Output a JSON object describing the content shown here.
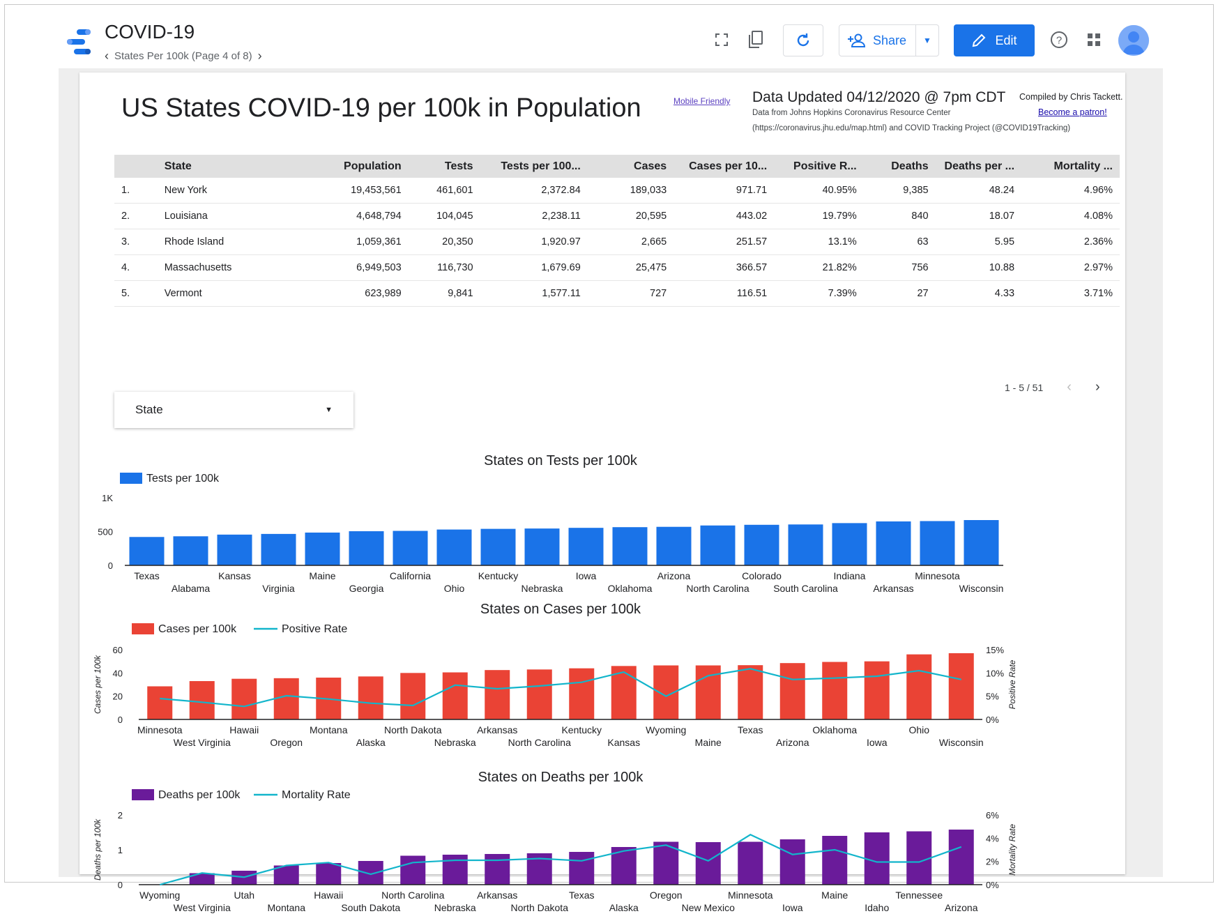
{
  "app": {
    "title": "COVID-19",
    "page_nav": "States Per 100k (Page 4 of 8)"
  },
  "toolbar": {
    "share_label": "Share",
    "edit_label": "Edit"
  },
  "report": {
    "title": "US States COVID-19 per 100k in Population",
    "mobile_link": "Mobile Friendly",
    "updated": "Data Updated 04/12/2020 @ 7pm CDT",
    "source_line1": "Data from Johns Hopkins Coronavirus Resource Center",
    "source_line2": "(https://coronavirus.jhu.edu/map.html) and COVID Tracking Project (@COVID19Tracking)",
    "compiled": "Compiled by Chris Tackett.",
    "patron_link": "Become a patron!"
  },
  "table": {
    "headers": [
      "State",
      "Population",
      "Tests",
      "Tests per 100...",
      "Cases",
      "Cases per 10...",
      "Positive R...",
      "Deaths",
      "Deaths per ...",
      "Mortality ..."
    ],
    "rows": [
      [
        "1.",
        "New York",
        "19,453,561",
        "461,601",
        "2,372.84",
        "189,033",
        "971.71",
        "40.95%",
        "9,385",
        "48.24",
        "4.96%"
      ],
      [
        "2.",
        "Louisiana",
        "4,648,794",
        "104,045",
        "2,238.11",
        "20,595",
        "443.02",
        "19.79%",
        "840",
        "18.07",
        "4.08%"
      ],
      [
        "3.",
        "Rhode Island",
        "1,059,361",
        "20,350",
        "1,920.97",
        "2,665",
        "251.57",
        "13.1%",
        "63",
        "5.95",
        "2.36%"
      ],
      [
        "4.",
        "Massachusetts",
        "6,949,503",
        "116,730",
        "1,679.69",
        "25,475",
        "366.57",
        "21.82%",
        "756",
        "10.88",
        "2.97%"
      ],
      [
        "5.",
        "Vermont",
        "623,989",
        "9,841",
        "1,577.11",
        "727",
        "116.51",
        "7.39%",
        "27",
        "4.33",
        "3.71%"
      ]
    ],
    "pager": "1 - 5 / 51"
  },
  "filter": {
    "label": "State"
  },
  "chart_data": [
    {
      "type": "bar",
      "title": "States on Tests per 100k",
      "categories": [
        "Texas",
        "Alabama",
        "Kansas",
        "Virginia",
        "Maine",
        "Georgia",
        "California",
        "Ohio",
        "Kentucky",
        "Nebraska",
        "Iowa",
        "Oklahoma",
        "Arizona",
        "North Carolina",
        "Colorado",
        "South Carolina",
        "Indiana",
        "Arkansas",
        "Minnesota",
        "Wisconsin"
      ],
      "series": [
        {
          "name": "Tests per 100k",
          "values": [
            420,
            430,
            455,
            465,
            485,
            505,
            510,
            530,
            540,
            545,
            555,
            565,
            570,
            590,
            600,
            605,
            625,
            650,
            655,
            670
          ]
        }
      ],
      "y_ticks": [
        "1K",
        "500",
        "0"
      ],
      "ylim": [
        0,
        1000
      ],
      "color": "#1a73e8",
      "legend": "top-left"
    },
    {
      "type": "bar",
      "title": "States on Cases per 100k",
      "categories": [
        "Minnesota",
        "West Virginia",
        "Hawaii",
        "Oregon",
        "Montana",
        "Alaska",
        "North Dakota",
        "Nebraska",
        "Arkansas",
        "North Carolina",
        "Kentucky",
        "Kansas",
        "Wyoming",
        "Maine",
        "Texas",
        "Arizona",
        "Oklahoma",
        "Iowa",
        "Ohio",
        "Wisconsin"
      ],
      "series": [
        {
          "name": "Cases per 100k",
          "axis": "left",
          "values": [
            28.5,
            33,
            35,
            35.5,
            36,
            37,
            40,
            40.5,
            42.5,
            43,
            44,
            46,
            46.5,
            46.5,
            46.7,
            48.5,
            49.5,
            50,
            56,
            57
          ]
        },
        {
          "name": "Positive Rate",
          "axis": "right",
          "values": [
            4.5,
            3.7,
            2.8,
            5.1,
            4.4,
            3.5,
            3.0,
            7.4,
            6.6,
            7.2,
            8.0,
            10.2,
            5.0,
            9.4,
            10.9,
            8.6,
            8.9,
            9.3,
            10.5,
            8.6
          ]
        }
      ],
      "ylabel": "Cases per 100k",
      "y2label": "Positive Rate",
      "y_ticks": [
        "60",
        "40",
        "20",
        "0"
      ],
      "y2_ticks": [
        "15%",
        "10%",
        "5%",
        "0%"
      ],
      "ylim": [
        0,
        60
      ],
      "y2lim": [
        0,
        15
      ],
      "colors": [
        "#ea4335",
        "#12b5cb"
      ],
      "legend": "top-left"
    },
    {
      "type": "bar",
      "title": "States on Deaths per 100k",
      "categories": [
        "Wyoming",
        "West Virginia",
        "Utah",
        "Montana",
        "Hawaii",
        "South Dakota",
        "North Carolina",
        "Nebraska",
        "Arkansas",
        "North Dakota",
        "Texas",
        "Alaska",
        "Oregon",
        "New Mexico",
        "Minnesota",
        "Iowa",
        "Maine",
        "Idaho",
        "Tennessee",
        "Arizona"
      ],
      "series": [
        {
          "name": "Deaths per 100k",
          "axis": "left",
          "values": [
            0,
            0.33,
            0.4,
            0.55,
            0.62,
            0.68,
            0.83,
            0.86,
            0.88,
            0.9,
            0.94,
            1.08,
            1.23,
            1.22,
            1.23,
            1.3,
            1.4,
            1.5,
            1.53,
            1.58
          ]
        },
        {
          "name": "Mortality Rate",
          "axis": "right",
          "values": [
            0,
            1.0,
            0.65,
            1.65,
            1.9,
            0.9,
            1.9,
            2.1,
            2.1,
            2.25,
            2.05,
            2.9,
            3.4,
            2.05,
            4.3,
            2.6,
            3.0,
            1.95,
            1.95,
            3.25
          ]
        }
      ],
      "ylabel": "Deaths per 100k",
      "y2label": "Mortality Rate",
      "y_ticks": [
        "2",
        "1",
        "0"
      ],
      "y2_ticks": [
        "6%",
        "4%",
        "2%",
        "0%"
      ],
      "ylim": [
        0,
        2
      ],
      "y2lim": [
        0,
        6
      ],
      "colors": [
        "#6a1b9a",
        "#12b5cb"
      ],
      "legend": "top-left"
    }
  ]
}
